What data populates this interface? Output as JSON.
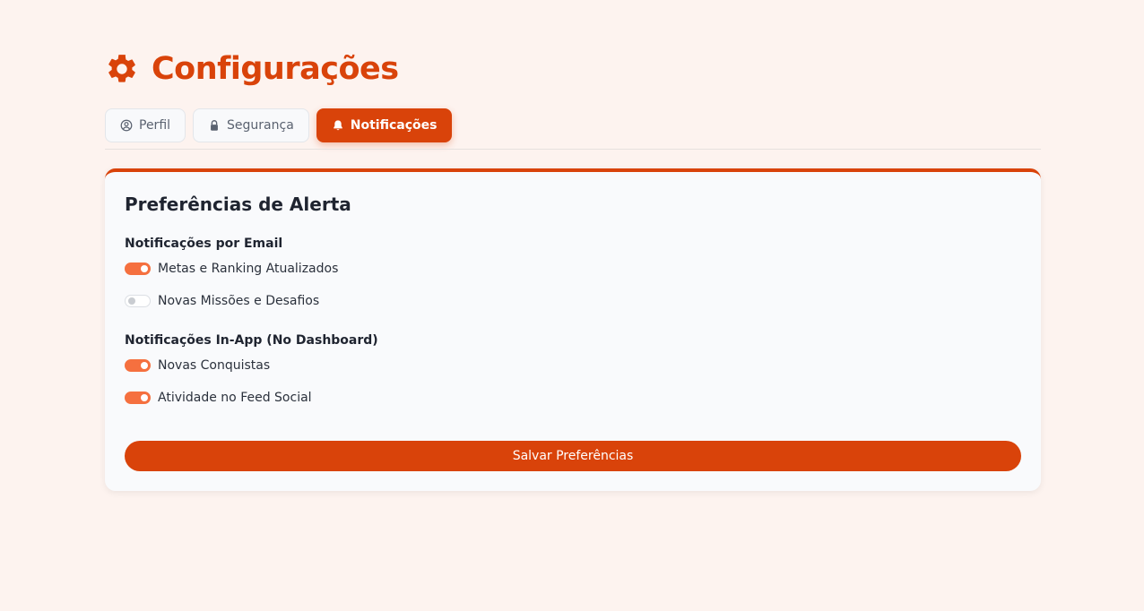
{
  "page": {
    "title": "Configurações",
    "icon": "gear-icon",
    "accent_color": "#d9430a"
  },
  "tabs": [
    {
      "label": "Perfil",
      "icon": "user-circle-icon",
      "active": false
    },
    {
      "label": "Segurança",
      "icon": "lock-icon",
      "active": false
    },
    {
      "label": "Notificações",
      "icon": "bell-icon",
      "active": true
    }
  ],
  "card": {
    "title": "Preferências de Alerta",
    "sections": [
      {
        "title": "Notificações por Email",
        "items": [
          {
            "label": "Metas e Ranking Atualizados",
            "enabled": true
          },
          {
            "label": "Novas Missões e Desafios",
            "enabled": false
          }
        ]
      },
      {
        "title": "Notificações In-App (No Dashboard)",
        "items": [
          {
            "label": "Novas Conquistas",
            "enabled": true
          },
          {
            "label": "Atividade no Feed Social",
            "enabled": true
          }
        ]
      }
    ],
    "save_label": "Salvar Preferências"
  }
}
